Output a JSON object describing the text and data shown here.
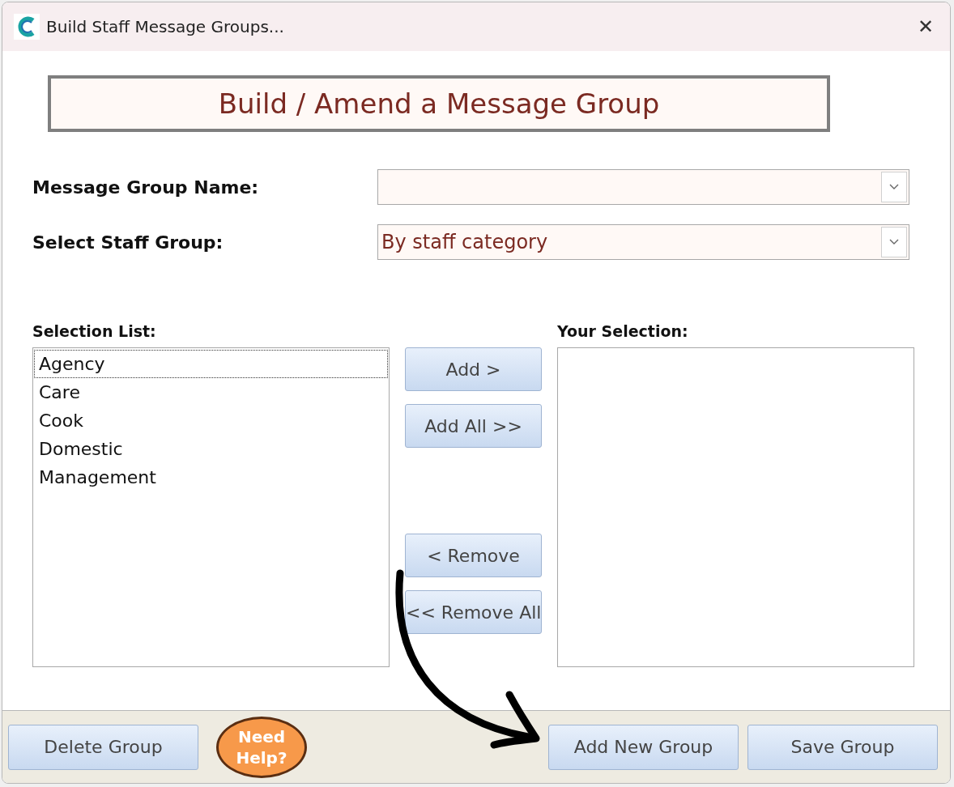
{
  "window": {
    "title": "Build Staff Message Groups...",
    "close": "✕"
  },
  "heading": "Build / Amend a Message Group",
  "fields": [
    {
      "label": "Message Group Name:"
    },
    {
      "label": "Select Staff Group:",
      "value": "By staff category"
    }
  ],
  "selection_list": {
    "label": "Selection List:",
    "items": [
      {
        "text": "Agency",
        "selected": true
      },
      {
        "text": "Care",
        "selected": false
      },
      {
        "text": "Cook",
        "selected": false
      },
      {
        "text": "Domestic",
        "selected": false
      },
      {
        "text": "Management",
        "selected": false
      }
    ]
  },
  "add_buttons": [
    "Add >",
    "Add All >>"
  ],
  "remove_buttons": [
    "< Remove",
    "<< Remove All"
  ],
  "your_selection": {
    "label": "Your Selection:"
  },
  "footer": {
    "left_button": "Delete Group",
    "help": "Need Help?",
    "right_buttons": [
      "Add New Group",
      "Save Group"
    ]
  }
}
